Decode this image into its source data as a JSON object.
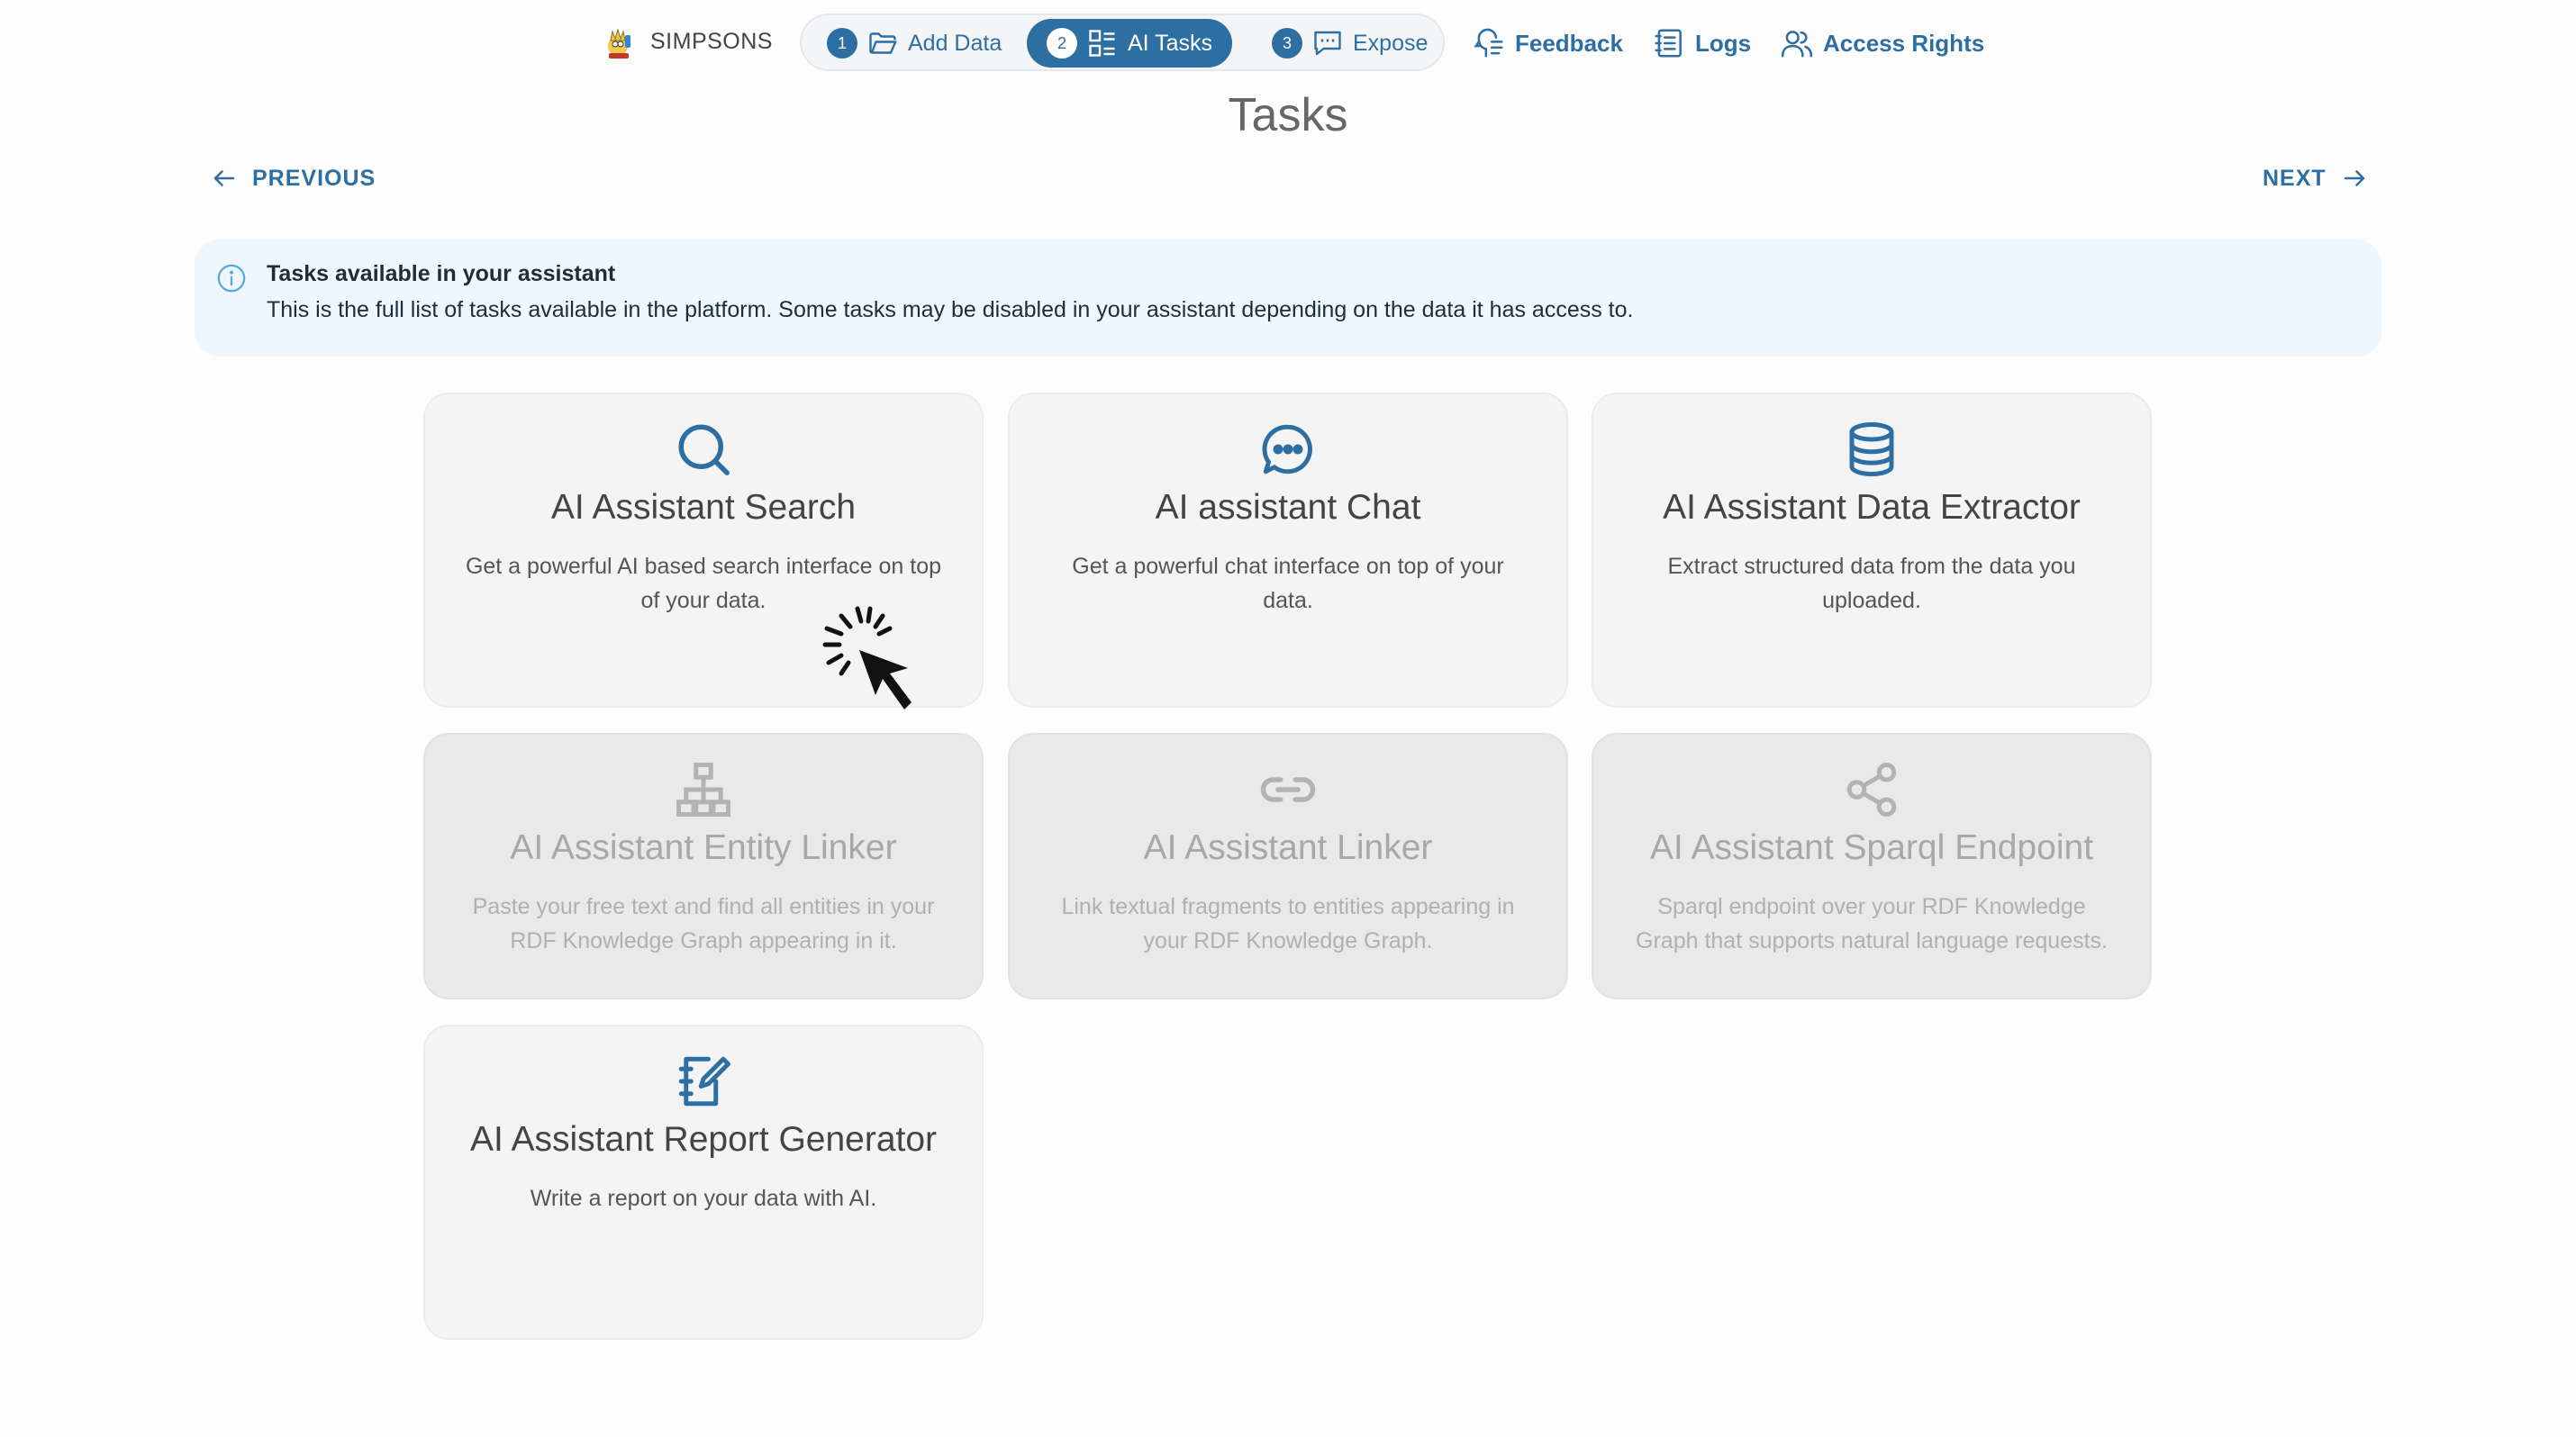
{
  "header": {
    "brand": "SIMPSONS",
    "steps": [
      {
        "number": "1",
        "label": "Add Data",
        "icon": "folder-icon",
        "active": false
      },
      {
        "number": "2",
        "label": "AI Tasks",
        "icon": "task-list-icon",
        "active": true
      },
      {
        "number": "3",
        "label": "Expose",
        "icon": "message-square-icon",
        "active": false
      }
    ],
    "links": [
      {
        "label": "Feedback",
        "icon": "feedback-icon"
      },
      {
        "label": "Logs",
        "icon": "logs-icon"
      },
      {
        "label": "Access Rights",
        "icon": "users-icon"
      }
    ]
  },
  "page": {
    "title": "Tasks",
    "previous": "PREVIOUS",
    "next": "NEXT"
  },
  "info": {
    "heading": "Tasks available in your assistant",
    "text": "This is the full list of tasks available in the platform. Some tasks may be disabled in your assistant depending on the data it has access to."
  },
  "tasks": [
    {
      "title": "AI Assistant Search",
      "description": "Get a powerful AI based search interface on top of your data.",
      "icon": "search-icon",
      "enabled": true
    },
    {
      "title": "AI assistant Chat",
      "description": "Get a powerful chat interface on top of your data.",
      "icon": "chat-bubble-icon",
      "enabled": true
    },
    {
      "title": "AI Assistant Data Extractor",
      "description": "Extract structured data from the data you uploaded.",
      "icon": "database-icon",
      "enabled": true
    },
    {
      "title": "AI Assistant Entity Linker",
      "description": "Paste your free text and find all entities in your RDF Knowledge Graph appearing in it.",
      "icon": "hierarchy-icon",
      "enabled": false
    },
    {
      "title": "AI Assistant Linker",
      "description": "Link textual fragments to entities appearing in your RDF Knowledge Graph.",
      "icon": "link-icon",
      "enabled": false
    },
    {
      "title": "AI Assistant Sparql Endpoint",
      "description": "Sparql endpoint over your RDF Knowledge Graph that supports natural language requests.",
      "icon": "share-icon",
      "enabled": false
    },
    {
      "title": "AI Assistant Report Generator",
      "description": "Write a report on your data with AI.",
      "icon": "notebook-edit-icon",
      "enabled": true
    }
  ],
  "colors": {
    "accent": "#2e6fa3",
    "info_background": "#eef7fd",
    "card_enabled": "#f4f4f4",
    "card_disabled": "#e9e9e9"
  }
}
